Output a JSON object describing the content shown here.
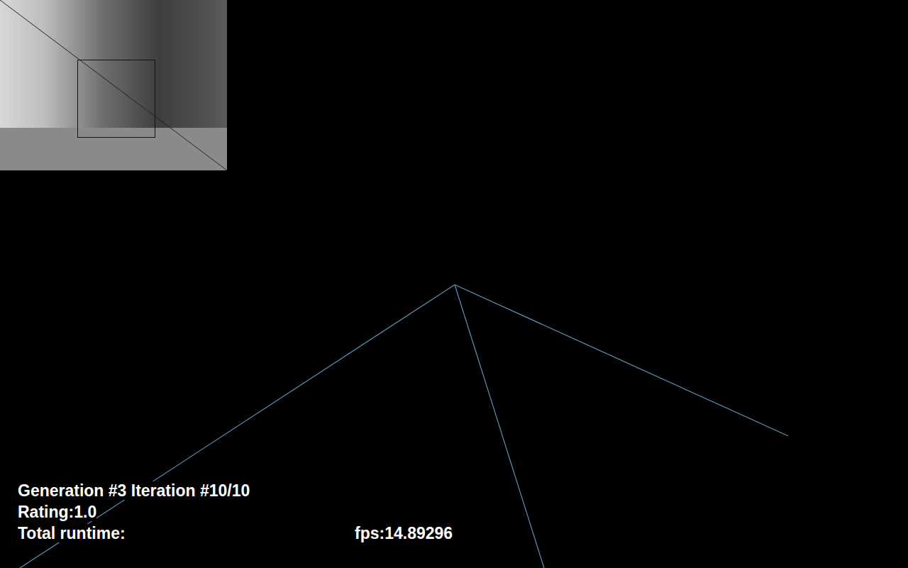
{
  "camera": {
    "face_detected": true
  },
  "status": {
    "generation": "Generation #3 Iteration #10/10",
    "rating": "Rating:1.0",
    "runtime_label": "Total runtime:",
    "fps": "fps:14.89296"
  }
}
